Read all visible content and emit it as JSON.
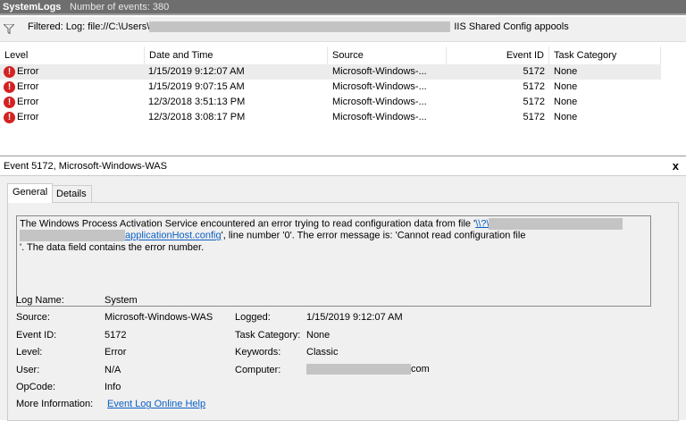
{
  "topbar": {
    "title": "SystemLogs",
    "count": "Number of events: 380"
  },
  "filter": {
    "prefix": "Filtered: Log: file://C:\\Users\\",
    "suffix": "IIS Shared Config appools"
  },
  "columns": [
    "Level",
    "Date and Time",
    "Source",
    "Event ID",
    "Task Category"
  ],
  "rows": [
    {
      "level": "Error",
      "date": "1/15/2019 9:12:07 AM",
      "source": "Microsoft-Windows-...",
      "id": "5172",
      "task": "None"
    },
    {
      "level": "Error",
      "date": "1/15/2019 9:07:15 AM",
      "source": "Microsoft-Windows-...",
      "id": "5172",
      "task": "None"
    },
    {
      "level": "Error",
      "date": "12/3/2018 3:51:13 PM",
      "source": "Microsoft-Windows-...",
      "id": "5172",
      "task": "None"
    },
    {
      "level": "Error",
      "date": "12/3/2018 3:08:17 PM",
      "source": "Microsoft-Windows-...",
      "id": "5172",
      "task": "None"
    }
  ],
  "detail": {
    "title": "Event 5172, Microsoft-Windows-WAS",
    "close": "x",
    "tabs": [
      "General",
      "Details"
    ],
    "message": {
      "part1": "The Windows Process Activation Service encountered an error trying to read configuration data from file '",
      "link1": "\\\\?\\",
      "link2": "applicationHost.config",
      "part2": "', line number '0'.  The error message is: 'Cannot read configuration file",
      "part3": "'.  The data field contains the error number."
    },
    "props": {
      "log_name_label": "Log Name:",
      "log_name": "System",
      "source_label": "Source:",
      "source": "Microsoft-Windows-WAS",
      "logged_label": "Logged:",
      "logged": "1/15/2019 9:12:07 AM",
      "event_id_label": "Event ID:",
      "event_id": "5172",
      "task_label": "Task Category:",
      "task": "None",
      "level_label": "Level:",
      "level": "Error",
      "keywords_label": "Keywords:",
      "keywords": "Classic",
      "user_label": "User:",
      "user": "N/A",
      "computer_label": "Computer:",
      "computer_suffix": "com",
      "opcode_label": "OpCode:",
      "opcode": "Info",
      "more_label": "More Information:",
      "more_link": "Event Log Online Help"
    }
  }
}
